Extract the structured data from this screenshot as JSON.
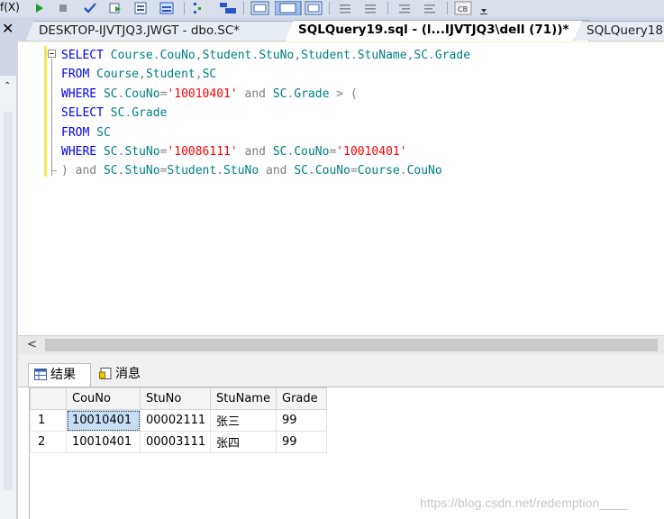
{
  "toolbar": {
    "menu_fragment": "f(X)",
    "icons": [
      "execute-icon",
      "stop-icon",
      "parse-checkmark-icon",
      "debug-icon",
      "display-plan-icon",
      "query-options-icon",
      "include-plan-icon",
      "results-to-text-icon",
      "results-to-grid-icon",
      "results-to-file-icon",
      "comment-icon",
      "uncomment-icon",
      "decrease-indent-icon",
      "increase-indent-icon",
      "specify-values-icon"
    ]
  },
  "tabs": [
    {
      "label": "DESKTOP-IJVTJQ3.JWGT - dbo.SC*",
      "active": false
    },
    {
      "label": "SQLQuery19.sql - (l...IJVTJQ3\\dell (71))*",
      "active": true
    },
    {
      "label": "SQLQuery18",
      "active": false
    }
  ],
  "editor": {
    "lines": [
      [
        [
          "kw",
          "SELECT"
        ],
        [
          "id",
          " Course"
        ],
        [
          "op",
          "."
        ],
        [
          "id",
          "CouNo"
        ],
        [
          "op",
          ","
        ],
        [
          "id",
          "Student"
        ],
        [
          "op",
          "."
        ],
        [
          "id",
          "StuNo"
        ],
        [
          "op",
          ","
        ],
        [
          "id",
          "Student"
        ],
        [
          "op",
          "."
        ],
        [
          "id",
          "StuName"
        ],
        [
          "op",
          ","
        ],
        [
          "id",
          "SC"
        ],
        [
          "op",
          "."
        ],
        [
          "id",
          "Grade"
        ]
      ],
      [
        [
          "kw",
          "FROM"
        ],
        [
          "id",
          " Course"
        ],
        [
          "op",
          ","
        ],
        [
          "id",
          "Student"
        ],
        [
          "op",
          ","
        ],
        [
          "id",
          "SC"
        ]
      ],
      [
        [
          "kw",
          "WHERE"
        ],
        [
          "id",
          " SC"
        ],
        [
          "op",
          "."
        ],
        [
          "id",
          "CouNo"
        ],
        [
          "op",
          "="
        ],
        [
          "str",
          "'10010401'"
        ],
        [
          "op",
          " and "
        ],
        [
          "id",
          "SC"
        ],
        [
          "op",
          "."
        ],
        [
          "id",
          "Grade"
        ],
        [
          "op",
          " > ("
        ]
      ],
      [
        [
          "kw",
          "SELECT"
        ],
        [
          "id",
          " SC"
        ],
        [
          "op",
          "."
        ],
        [
          "id",
          "Grade"
        ]
      ],
      [
        [
          "kw",
          "FROM"
        ],
        [
          "id",
          " SC"
        ]
      ],
      [
        [
          "kw",
          "WHERE"
        ],
        [
          "id",
          " SC"
        ],
        [
          "op",
          "."
        ],
        [
          "id",
          "StuNo"
        ],
        [
          "op",
          "="
        ],
        [
          "str",
          "'10086111'"
        ],
        [
          "op",
          " and "
        ],
        [
          "id",
          "SC"
        ],
        [
          "op",
          "."
        ],
        [
          "id",
          "CouNo"
        ],
        [
          "op",
          "="
        ],
        [
          "str",
          "'10010401'"
        ]
      ],
      [
        [
          "op",
          ") and "
        ],
        [
          "id",
          "SC"
        ],
        [
          "op",
          "."
        ],
        [
          "id",
          "StuNo"
        ],
        [
          "op",
          "="
        ],
        [
          "id",
          "Student"
        ],
        [
          "op",
          "."
        ],
        [
          "id",
          "StuNo"
        ],
        [
          "op",
          " and "
        ],
        [
          "id",
          "SC"
        ],
        [
          "op",
          "."
        ],
        [
          "id",
          "CouNo"
        ],
        [
          "op",
          "="
        ],
        [
          "id",
          "Course"
        ],
        [
          "op",
          "."
        ],
        [
          "id",
          "CouNo"
        ]
      ]
    ]
  },
  "results": {
    "tabs": [
      {
        "label": "结果",
        "icon": "grid-results-icon",
        "active": true
      },
      {
        "label": "消息",
        "icon": "messages-icon",
        "active": false
      }
    ],
    "columns": [
      "CouNo",
      "StuNo",
      "StuName",
      "Grade"
    ],
    "rows": [
      {
        "num": "1",
        "cells": [
          "10010401",
          "00002111",
          "张三",
          "99"
        ]
      },
      {
        "num": "2",
        "cells": [
          "10010401",
          "00003111",
          "张四",
          "99"
        ]
      }
    ]
  },
  "watermark": "https://blog.csdn.net/redemption____",
  "colors": {
    "keyword": "#0000ff",
    "identifier": "#008080",
    "string": "#ff0000",
    "operator": "#808080",
    "selected_cell": "#c9def5"
  }
}
